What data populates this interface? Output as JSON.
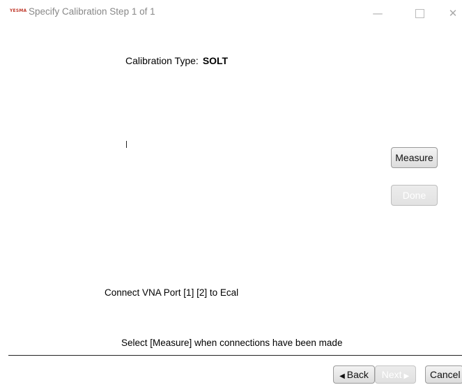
{
  "window": {
    "logo_text": "YESMA",
    "title": "Specify Calibration Step 1 of 1",
    "controls": {
      "minimize": "—",
      "close": "✕"
    }
  },
  "calibration": {
    "label": "Calibration Type:",
    "value": "SOLT"
  },
  "buttons": {
    "measure": "Measure",
    "done": "Done",
    "back": "Back",
    "back_arrow": "◀",
    "next": "Next",
    "next_arrow": "▶",
    "cancel": "Cancel"
  },
  "instructions": {
    "connect": "Connect VNA Port [1] [2] to Ecal",
    "select": "Select [Measure] when connections have been made"
  }
}
